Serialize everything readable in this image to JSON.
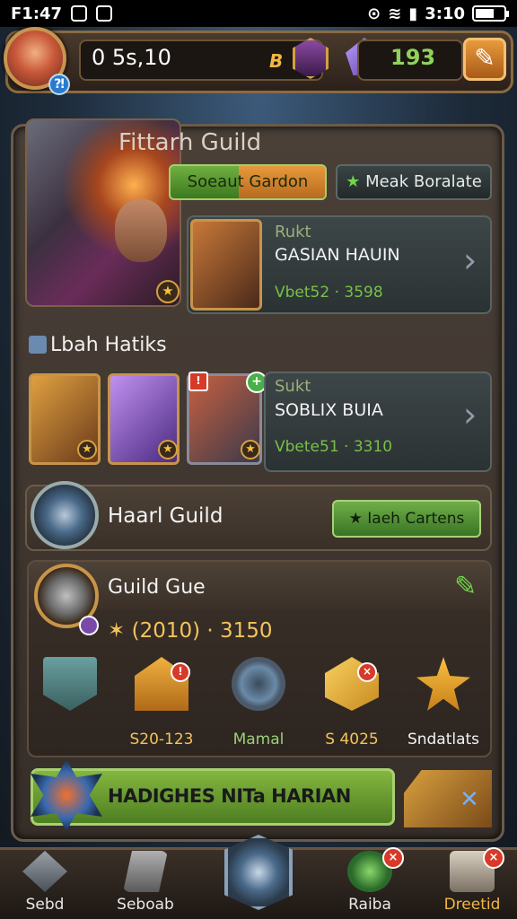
{
  "status_bar": {
    "time_left": "F1:47",
    "time_right": "3:10"
  },
  "resources": {
    "gold_value": "0 5s,10",
    "gold_icon_letter": "B",
    "gem_value": "193"
  },
  "guild": {
    "title": "Fittarh Guild",
    "btn_primary": "Soeaut Gardon",
    "btn_secondary": "Meak Boralate"
  },
  "card1": {
    "label": "Rukt",
    "name": "GASIAN HAUIN",
    "stat": "Vbet52 · 3598"
  },
  "section": {
    "title": "Lbah Hatiks"
  },
  "card2": {
    "label": "Sukt",
    "name": "SOBLIX BUIA",
    "stat": "Vbete51 · 3310"
  },
  "guild_row": {
    "name": "Haarl Guild",
    "button": "Iaeh Cartens"
  },
  "guild_gue": {
    "title": "Guild Gue",
    "stat": "(2010) · 3150",
    "items": [
      {
        "label": "S20-123",
        "color": "#f3c45a",
        "icon": "shield-icon"
      },
      {
        "label": "Mamal",
        "color": "#9ad07a",
        "icon": "house-icon"
      },
      {
        "label": "",
        "color": "#ffffff",
        "icon": "gear-icon"
      },
      {
        "label": "S 4025",
        "color": "#f3c45a",
        "icon": "box-icon"
      },
      {
        "label": "Sndatlats",
        "color": "#f2f2f2",
        "icon": "star-icon"
      }
    ]
  },
  "banner": {
    "text": "HADIGHES NITa HARIAN"
  },
  "nav": {
    "items": [
      "Sebd",
      "Seboab",
      "Raiba",
      "Dreetid"
    ]
  },
  "colors": {
    "accent_green": "#6fb040",
    "accent_gold": "#d8a040",
    "badge_red": "#d83a2a"
  }
}
